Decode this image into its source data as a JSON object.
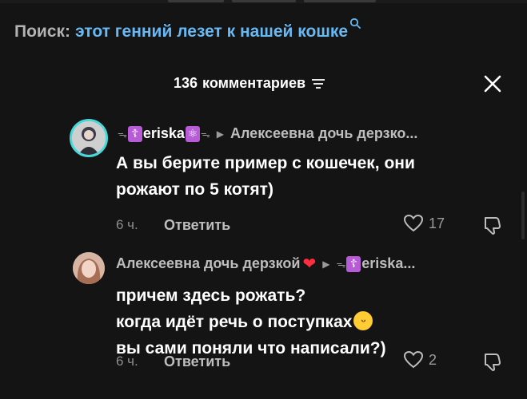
{
  "search": {
    "prefix": "Поиск:",
    "query": "этот генний лезет к нашей кошке"
  },
  "header": {
    "count": "136",
    "count_label": "комментариев"
  },
  "comments": [
    {
      "author": "eriska",
      "reply_to": "Алексеевна дочь дерзко...",
      "lines": [
        "А вы берите пример с кошечек, они",
        "рожают по 5 котят)"
      ],
      "time": "6 ч.",
      "reply_label": "Ответить",
      "likes": "17"
    },
    {
      "author": "Алексеевна дочь дерзкой",
      "reply_to": "eriska...",
      "lines": [
        "причем здесь рожать?",
        "когда идёт речь о поступках",
        "вы сами поняли что написали?)"
      ],
      "time": "6 ч.",
      "reply_label": "Ответить",
      "likes": "2"
    }
  ],
  "colors": {
    "accent_link": "#67b8f3",
    "avatar_ring": "#47d9d9",
    "badge": "#b85bd6",
    "heart": "#ff2d3d"
  },
  "icons": [
    "search-icon",
    "filter-icon",
    "close-icon",
    "heart-icon",
    "dislike-icon",
    "heart-emoji",
    "grinning-emoji"
  ]
}
